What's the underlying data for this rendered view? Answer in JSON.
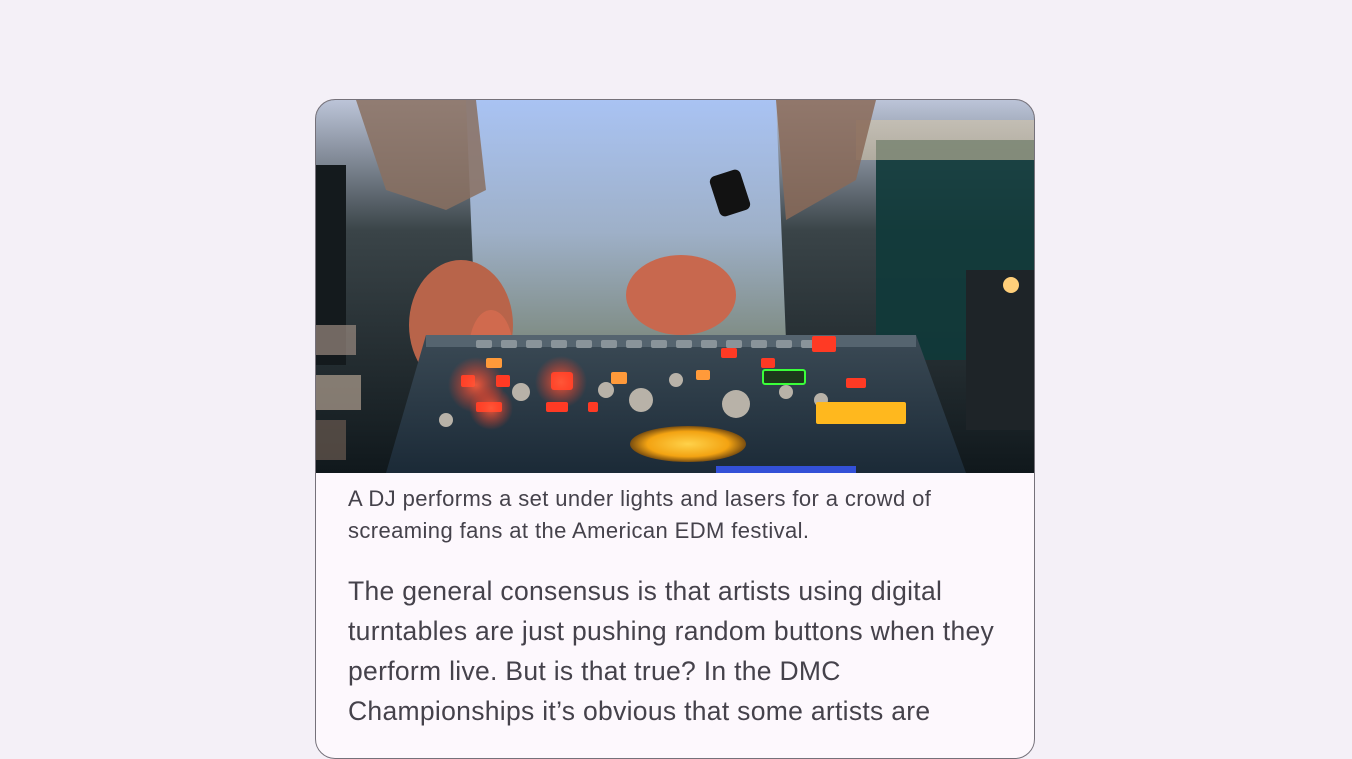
{
  "article": {
    "image_alt": "DJ performing on a lit-up drum machine controller",
    "caption": "A DJ performs a set under lights and lasers for a crowd of screaming fans at the American EDM festival.",
    "body": "The general consensus is that artists using digital turntables are just pushing random buttons when they perform live. But is that true? In the DMC Championships it’s obvious that some artists are"
  }
}
